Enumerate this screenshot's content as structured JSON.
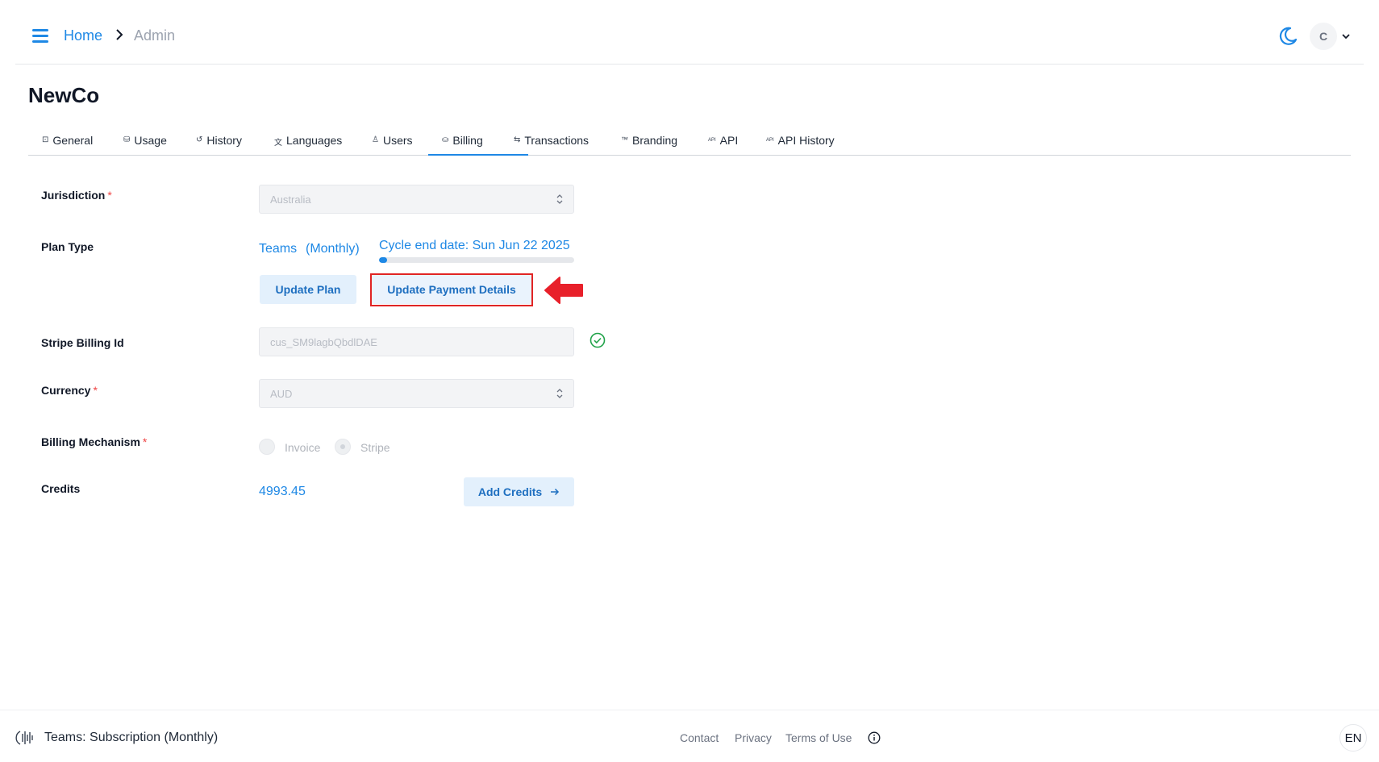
{
  "header": {
    "breadcrumb": {
      "home": "Home",
      "current": "Admin"
    },
    "avatar_initial": "C",
    "accent": "#1e88e5"
  },
  "page": {
    "title": "NewCo"
  },
  "tabs": [
    {
      "label": "General",
      "icon": "square-icon",
      "glyph": "⊡"
    },
    {
      "label": "Usage",
      "icon": "database-icon",
      "glyph": "⛁"
    },
    {
      "label": "History",
      "icon": "history-icon",
      "glyph": "↺"
    },
    {
      "label": "Languages",
      "icon": "translate-icon",
      "glyph": "文"
    },
    {
      "label": "Users",
      "icon": "user-icon",
      "glyph": "♙"
    },
    {
      "label": "Billing",
      "icon": "coins-icon",
      "glyph": "⛀",
      "active": true
    },
    {
      "label": "Transactions",
      "icon": "transfer-icon",
      "glyph": "⇆"
    },
    {
      "label": "Branding",
      "icon": "trademark-icon",
      "glyph": "™"
    },
    {
      "label": "API",
      "icon": "api-icon",
      "glyph": "API"
    },
    {
      "label": "API History",
      "icon": "api-history-icon",
      "glyph": "API"
    }
  ],
  "form": {
    "jurisdiction": {
      "label": "Jurisdiction",
      "value": "Australia"
    },
    "plan_type": {
      "label": "Plan Type",
      "plan": "Teams",
      "period": "(Monthly)",
      "cycle_text": "Cycle end date: Sun Jun 22 2025",
      "cycle_progress": 0.04,
      "update_plan": "Update Plan",
      "update_payment": "Update Payment Details"
    },
    "stripe_billing": {
      "label": "Stripe Billing Id",
      "value": "cus_SM9lagbQbdlDAE",
      "status_icon": "check-circle-icon"
    },
    "currency": {
      "label": "Currency",
      "value": "AUD"
    },
    "billing_mechanism": {
      "label": "Billing Mechanism",
      "options": [
        "Invoice",
        "Stripe"
      ],
      "selected": "Stripe"
    },
    "credits": {
      "label": "Credits",
      "value": "4993.45",
      "add_button": "Add Credits"
    },
    "required_mark": "*"
  },
  "annotation": {
    "highlight_color": "#e02424"
  },
  "footer": {
    "plan_text": "Teams: Subscription (Monthly)",
    "links": [
      "Contact",
      "Privacy",
      "Terms of Use"
    ],
    "language": "EN"
  }
}
